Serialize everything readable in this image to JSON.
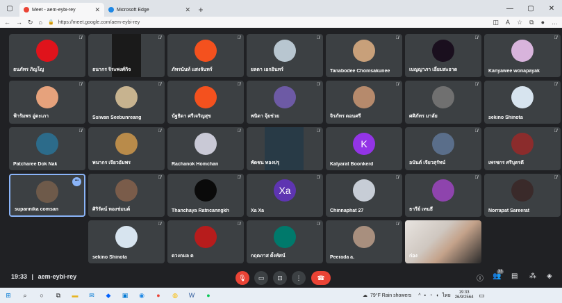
{
  "browser": {
    "tabs": [
      {
        "title": "Meet - aem-eybi-rey",
        "active": true
      },
      {
        "title": "Microsoft Edge",
        "active": false
      }
    ],
    "url": "https://meet.google.com/aem-eybi-rey"
  },
  "meeting": {
    "time": "19:33",
    "separator": "|",
    "code": "aem-eybi-rey",
    "participant_count": "33"
  },
  "participants": [
    {
      "name": "ธนภัทร ภิญโญ",
      "avatar_color": "#e0131b",
      "muted": true
    },
    {
      "name": "ธนากร จิระพงศ์กิจ",
      "avatar_color": "#1a1a1a",
      "muted": true
    },
    {
      "name": "ภัทรนันท์ แสงจันทร์",
      "avatar_color": "#f4511e",
      "muted": true
    },
    {
      "name": "ยลดา เอกอินทร์",
      "avatar_color": "#b8c6d0",
      "muted": true
    },
    {
      "name": "Tanabodee Chomsakunee",
      "avatar_color": "#c8a07a",
      "muted": true
    },
    {
      "name": "เบญญาภา เอี่ยมสะอาด",
      "avatar_color": "#1a0f1e",
      "muted": true
    },
    {
      "name": "Kanyawee wonapayak",
      "avatar_color": "#d8b4dc",
      "muted": true
    },
    {
      "name": "ฟ้ารัมพร อู่ตะเภา",
      "avatar_color": "#e6a27c",
      "muted": true
    },
    {
      "name": "Ssiwan Seebunreang",
      "avatar_color": "#c7b38f",
      "muted": true
    },
    {
      "name": "นัฐธิดา ศรีเจริญสุข",
      "avatar_color": "#f4511e",
      "muted": true
    },
    {
      "name": "พนิดา จุ้ยช่วย",
      "avatar_color": "#6d5aa5",
      "muted": true
    },
    {
      "name": "จิรภัทร ดอนศรี",
      "avatar_color": "#b68a6c",
      "muted": true
    },
    {
      "name": "ศศิภัทร มาลัย",
      "avatar_color": "#707070",
      "muted": true
    },
    {
      "name": "sekino Shinota",
      "avatar_color": "#d7e4ef",
      "muted": true
    },
    {
      "name": "Patcharee Dok Nak",
      "avatar_color": "#2c6b8a",
      "muted": true
    },
    {
      "name": "พนากร เจียวอัมพร",
      "avatar_color": "#b98b4a",
      "muted": true
    },
    {
      "name": "Rachanok Homchan",
      "avatar_color": "#c9c9d6",
      "muted": true
    },
    {
      "name": "พัดชน ทองปรุ",
      "avatar_color": "#283a46",
      "muted": true
    },
    {
      "name": "Kalyarat Boonkerd",
      "avatar_color": "#9334e6",
      "initial": "K",
      "muted": false
    },
    {
      "name": "อนันต์ เจียวสุรัทน์",
      "avatar_color": "#5a6e8a",
      "muted": true
    },
    {
      "name": "เพรชกร ศรีบุตรดี",
      "avatar_color": "#8b2c2c",
      "muted": true
    },
    {
      "name": "supannika comsan",
      "avatar_color": "#6e5a4a",
      "muted": false
    },
    {
      "name": "ศิริรัตน์ ทองช่มนต์",
      "avatar_color": "#7a5c4a",
      "muted": true
    },
    {
      "name": "Thanchaya Ratncanngkh",
      "avatar_color": "#0a0a0a",
      "muted": true
    },
    {
      "name": "Xa Xa",
      "avatar_color": "#5e35b1",
      "initial": "Xa",
      "muted": true
    },
    {
      "name": "Chinnaphat 27",
      "avatar_color": "#c7cdd6",
      "muted": true
    },
    {
      "name": "ธารีย์ เทนธี",
      "avatar_color": "#8e44ad",
      "muted": true
    },
    {
      "name": "Norrapat Sareerat",
      "avatar_color": "#3a2a2a",
      "muted": true
    },
    {
      "name": "sekino Shinota",
      "avatar_color": "#d7e4ef",
      "muted": true
    },
    {
      "name": "ดวงกมล ต",
      "avatar_color": "#b71c1c",
      "muted": true
    },
    {
      "name": "กฤตภาส ตั้งทัศน์",
      "avatar_color": "#00796b",
      "muted": true
    },
    {
      "name": "Peerada a.",
      "avatar_color": "#a88f7e",
      "muted": true
    },
    {
      "name": "ก่อง",
      "avatar_color": "#c4a28a",
      "muted": false
    }
  ],
  "controls": {
    "mic": "mic-off",
    "camera": "camera-off",
    "present": "present",
    "more": "more",
    "leave": "leave-call"
  },
  "taskbar": {
    "weather": "79°F  Rain showers",
    "language": "ไทย",
    "time": "19:33",
    "date": "26/9/2564"
  },
  "colors": {
    "meet_bg": "#202124",
    "tile_bg": "#3c4043",
    "leave": "#ea4335",
    "accent": "#8ab4f8"
  }
}
